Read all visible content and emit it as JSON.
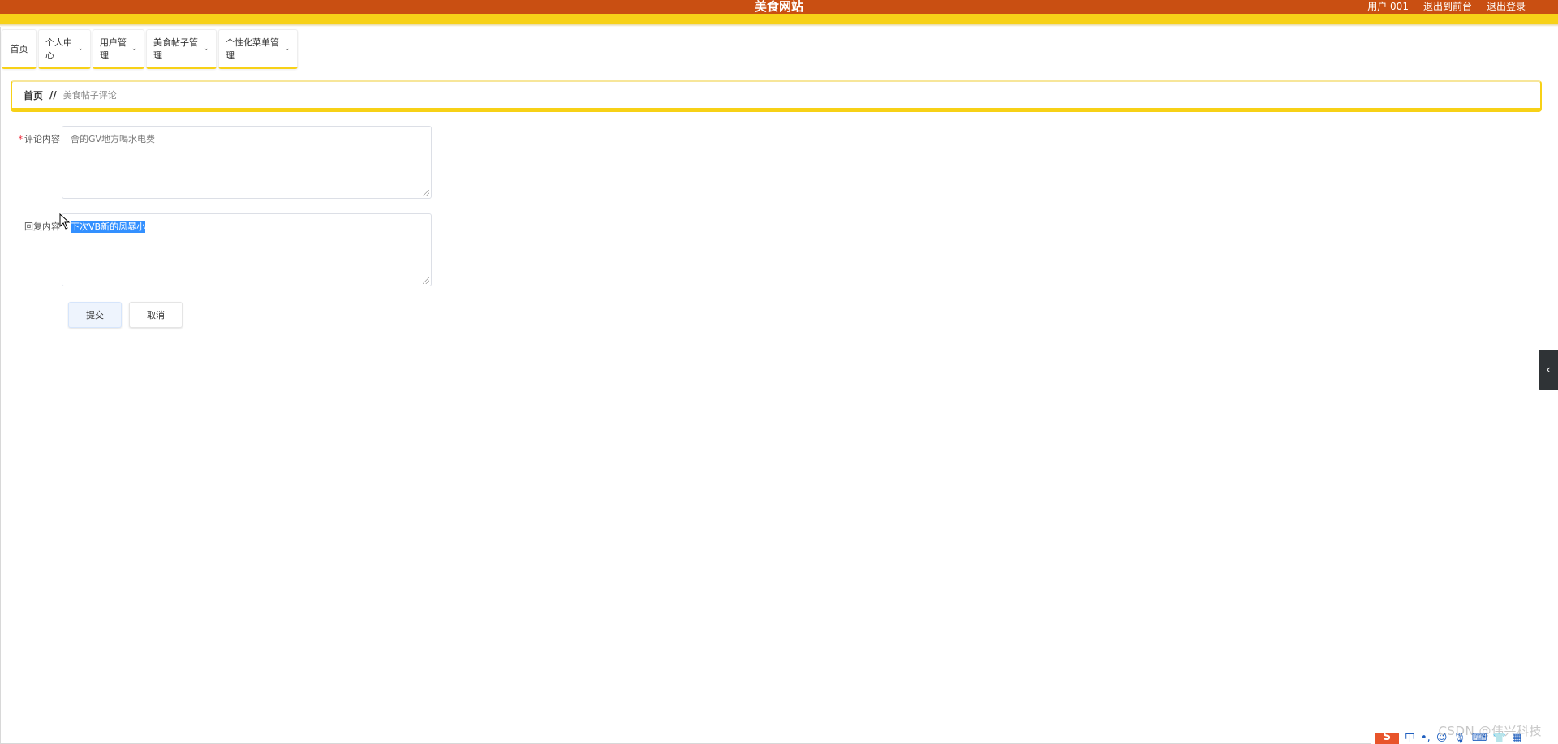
{
  "header": {
    "title": "美食网站",
    "user": "用户 001",
    "frontend_link": "退出到前台",
    "logout_link": "退出登录"
  },
  "nav": {
    "items": [
      {
        "label": "首页"
      },
      {
        "label": "个人中心"
      },
      {
        "label": "用户管理"
      },
      {
        "label": "美食帖子管理"
      },
      {
        "label": "个性化菜单管理"
      }
    ]
  },
  "breadcrumb": {
    "home": "首页",
    "separator": "//",
    "current": "美食帖子评论"
  },
  "form": {
    "comment_label": "评论内容",
    "comment_value": "舍的GV地方喝水电费",
    "reply_label": "回复内容",
    "reply_value": "下次VB新的风暴小"
  },
  "buttons": {
    "submit": "提交",
    "cancel": "取消"
  },
  "watermark": "CSDN @伟兴科技",
  "ime": {
    "logo": "S",
    "lang": "中"
  },
  "colors": {
    "header_bg": "#c94f12",
    "accent_yellow": "#f7d117",
    "selection": "#3390ff"
  }
}
